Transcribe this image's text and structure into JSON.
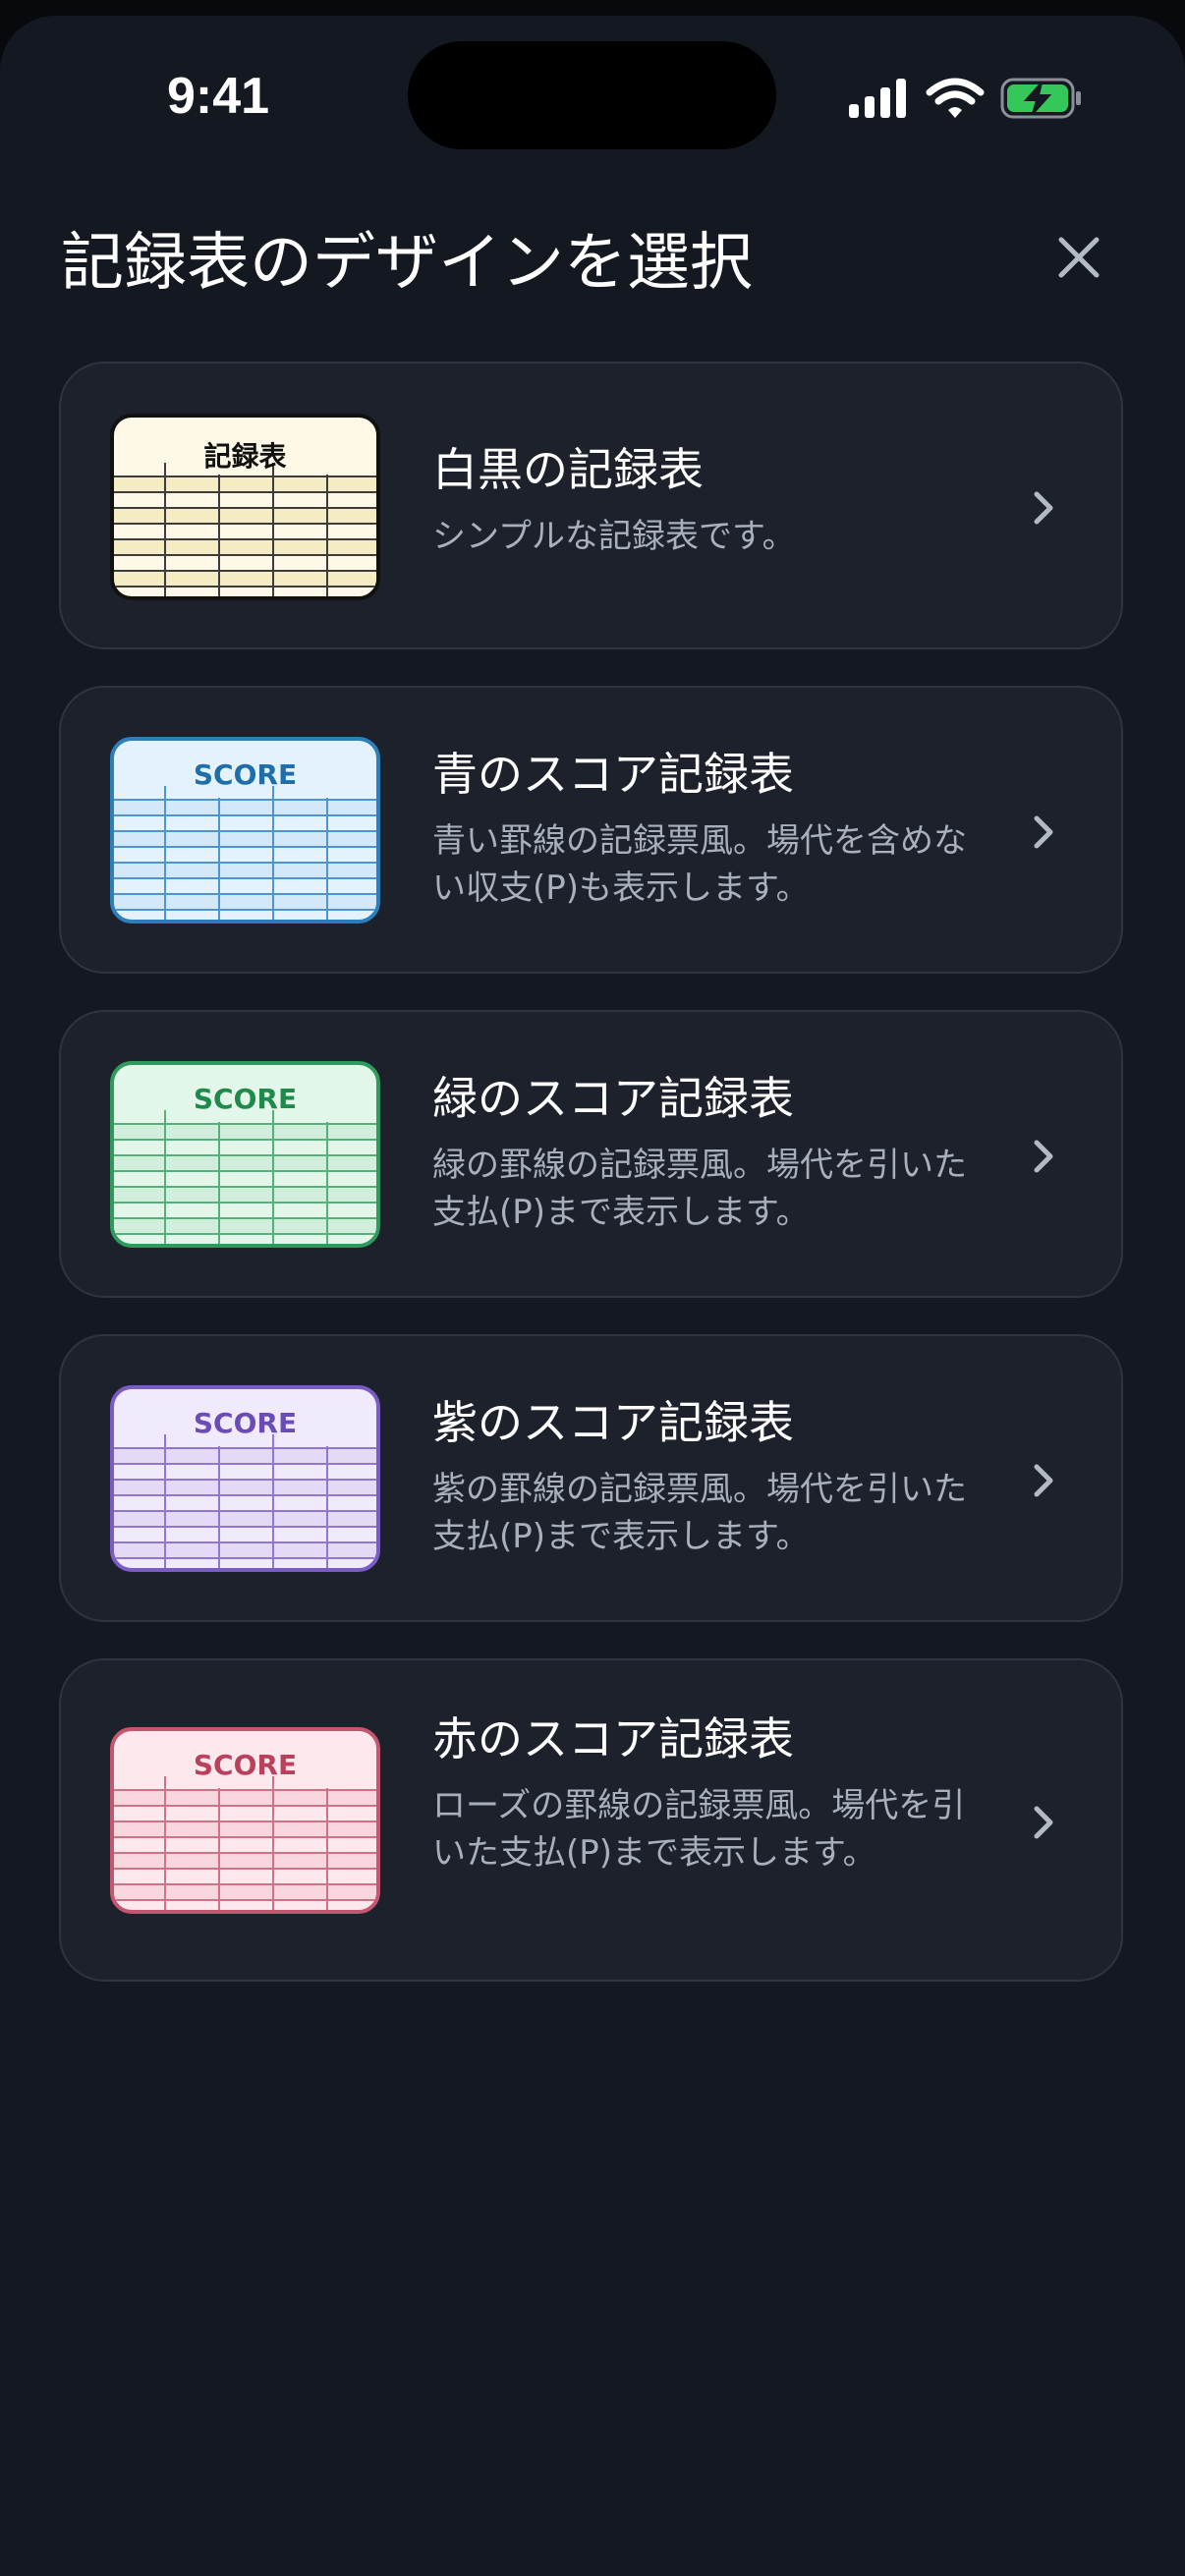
{
  "status_bar": {
    "time": "9:41"
  },
  "header": {
    "title": "記録表のデザインを選択",
    "close_icon": "close-icon"
  },
  "designs": [
    {
      "title": "白黒の記録表",
      "description": "シンプルな記録表です。",
      "thumb_label": "記録表",
      "colors": {
        "fill": "#fdf9e6",
        "border": "#111111",
        "line": "#3c3c3c",
        "label": "#111111",
        "stripe": "#f5ecc4"
      }
    },
    {
      "title": "青のスコア記録表",
      "description": "青い罫線の記録票風。場代を含めない収支(P)も表示します。",
      "thumb_label": "SCORE",
      "colors": {
        "fill": "#e4f2fd",
        "border": "#2d7fba",
        "line": "#4d95cc",
        "label": "#1f6ea8",
        "stripe": "#d3e8f8"
      }
    },
    {
      "title": "緑のスコア記録表",
      "description": "緑の罫線の記録票風。場代を引いた支払(P)まで表示します。",
      "thumb_label": "SCORE",
      "colors": {
        "fill": "#e3f6ea",
        "border": "#2f9a5c",
        "line": "#56b07b",
        "label": "#1f8a4c",
        "stripe": "#d1eedd"
      }
    },
    {
      "title": "紫のスコア記録表",
      "description": "紫の罫線の記録票風。場代を引いた支払(P)まで表示します。",
      "thumb_label": "SCORE",
      "colors": {
        "fill": "#f0eafc",
        "border": "#7b5cc4",
        "line": "#9077d0",
        "label": "#6a4bb8",
        "stripe": "#e4daf7"
      }
    },
    {
      "title": "赤のスコア記録表",
      "description": "ローズの罫線の記録票風。場代を引いた支払(P)まで表示します。",
      "thumb_label": "SCORE",
      "colors": {
        "fill": "#fde8ed",
        "border": "#c5566f",
        "line": "#d07286",
        "label": "#b8425c",
        "stripe": "#f8d6de"
      }
    }
  ]
}
